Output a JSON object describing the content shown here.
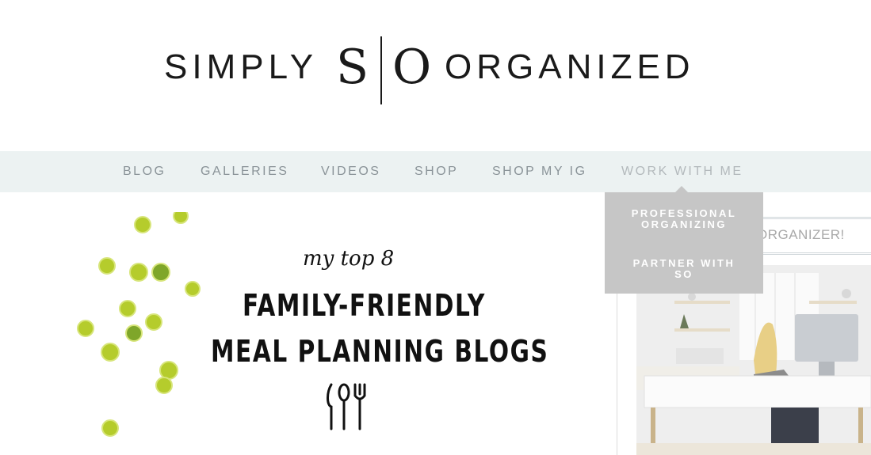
{
  "logo": {
    "left": "SIMPLY",
    "s": "S",
    "o": "O",
    "right": "ORGANIZED"
  },
  "nav": {
    "items": [
      "BLOG",
      "GALLERIES",
      "VIDEOS",
      "SHOP",
      "SHOP MY IG",
      "WORK WITH ME"
    ]
  },
  "dropdown": {
    "items": [
      {
        "line1": "PROFESSIONAL",
        "line2": "ORGANIZING"
      },
      {
        "line1": "PARTNER WITH",
        "line2": "SO"
      }
    ]
  },
  "sidebar": {
    "text": "ORGANIZER!"
  },
  "hero": {
    "subtitle": "my top 8",
    "line1": "FAMILY-FRIENDLY",
    "line2": "MEAL PLANNING BLOGS"
  },
  "colors": {
    "nav_bg": "#ecf2f2",
    "dropdown_bg": "#c6c6c6",
    "nav_text": "#8a9398",
    "lime": "#b5cc2c"
  }
}
